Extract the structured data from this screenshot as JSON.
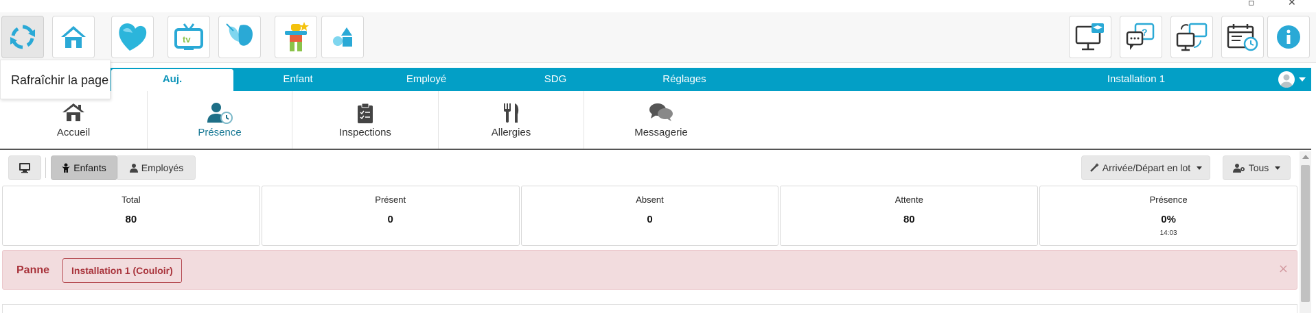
{
  "tooltip": {
    "text": "Rafraîchir la page"
  },
  "nav": {
    "tabs": [
      {
        "label": "Auj."
      },
      {
        "label": "Enfant"
      },
      {
        "label": "Employé"
      },
      {
        "label": "SDG"
      },
      {
        "label": "Réglages"
      }
    ],
    "installation": "Installation 1"
  },
  "subnav": {
    "items": [
      {
        "label": "Accueil",
        "icon": "house-icon"
      },
      {
        "label": "Présence",
        "icon": "user-clock-icon"
      },
      {
        "label": "Inspections",
        "icon": "clipboard-check-icon"
      },
      {
        "label": "Allergies",
        "icon": "utensils-icon"
      },
      {
        "label": "Messagerie",
        "icon": "chat-bubbles-icon"
      }
    ]
  },
  "toolbar": {
    "enfants": "Enfants",
    "employes": "Employés",
    "batch": "Arrivée/Départ en lot",
    "filter": "Tous"
  },
  "stats": [
    {
      "title": "Total",
      "value": "80"
    },
    {
      "title": "Présent",
      "value": "0"
    },
    {
      "title": "Absent",
      "value": "0"
    },
    {
      "title": "Attente",
      "value": "80"
    },
    {
      "title": "Présence",
      "value": "0%",
      "sub": "14:03"
    }
  ],
  "alert": {
    "label": "Panne",
    "location": "Installation 1 (Couloir)",
    "close": "×"
  },
  "colors": {
    "nav_blue": "#039fc6",
    "accent_teal": "#1a7a96",
    "alert_bg": "#f2dcde",
    "alert_text": "#a8323a"
  }
}
